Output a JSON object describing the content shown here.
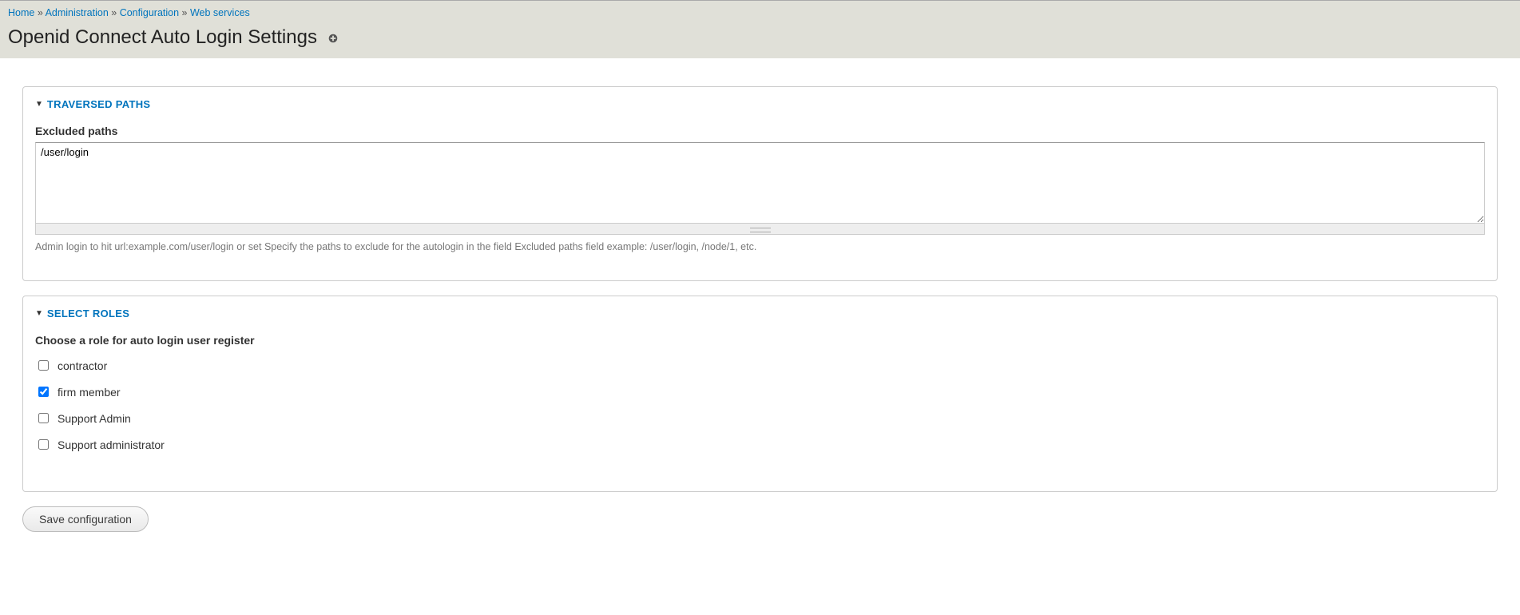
{
  "breadcrumb": {
    "items": [
      {
        "label": "Home"
      },
      {
        "label": "Administration"
      },
      {
        "label": "Configuration"
      },
      {
        "label": "Web services"
      }
    ],
    "separator": "»"
  },
  "page": {
    "title": "Openid Connect Auto Login Settings"
  },
  "panels": {
    "traversed": {
      "legend": "TRAVERSED PATHS",
      "excluded_label": "Excluded paths",
      "excluded_value": "/user/login",
      "description": "Admin login to hit url:example.com/user/login or set Specify the paths to exclude for the autologin in the field Excluded paths field example: /user/login, /node/1, etc."
    },
    "roles": {
      "legend": "SELECT ROLES",
      "choose_label": "Choose a role for auto login user register",
      "options": [
        {
          "label": "contractor",
          "checked": false
        },
        {
          "label": "firm member",
          "checked": true
        },
        {
          "label": "Support Admin",
          "checked": false
        },
        {
          "label": "Support administrator",
          "checked": false
        }
      ]
    }
  },
  "actions": {
    "save_label": "Save configuration"
  }
}
